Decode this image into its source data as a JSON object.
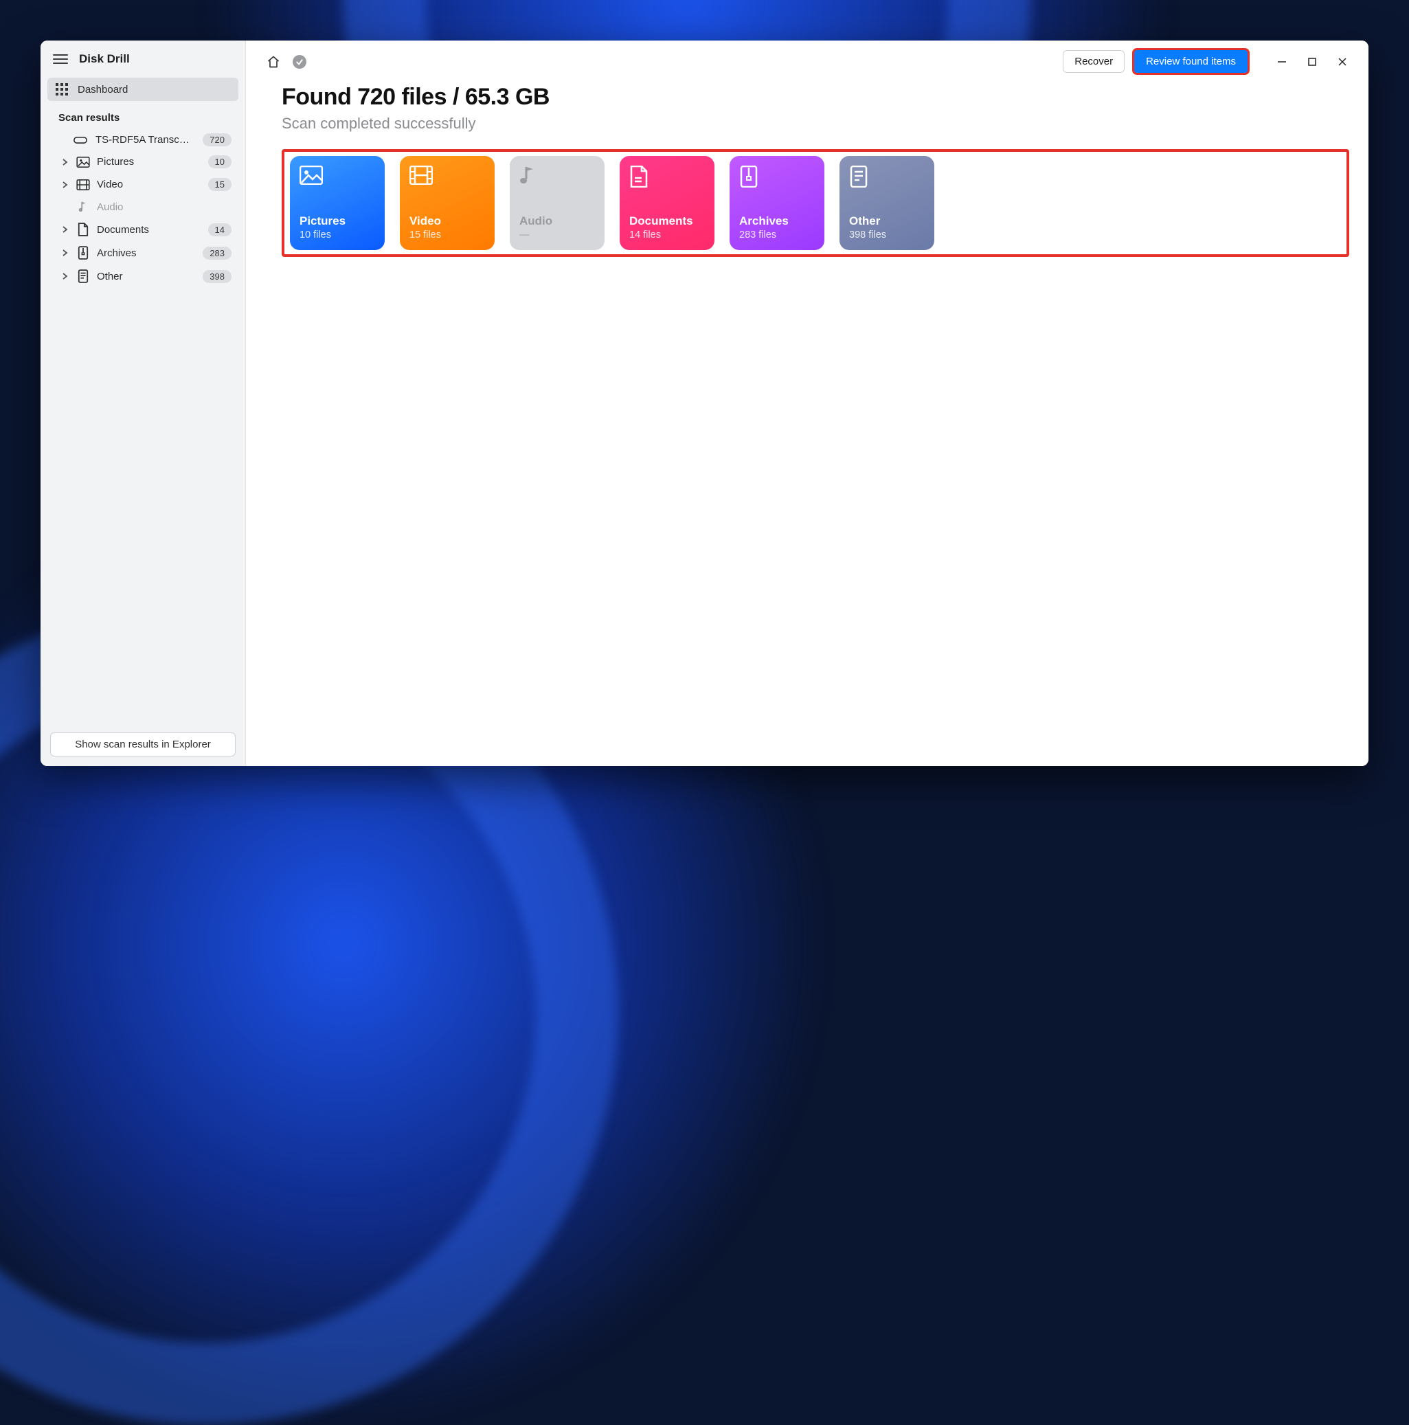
{
  "app": {
    "title": "Disk Drill"
  },
  "sidebar": {
    "dashboard_label": "Dashboard",
    "section_label": "Scan results",
    "device": {
      "name": "TS-RDF5A Transcend US…",
      "count": "720"
    },
    "items": [
      {
        "label": "Pictures",
        "count": "10",
        "disabled": false
      },
      {
        "label": "Video",
        "count": "15",
        "disabled": false
      },
      {
        "label": "Audio",
        "count": "",
        "disabled": true
      },
      {
        "label": "Documents",
        "count": "14",
        "disabled": false
      },
      {
        "label": "Archives",
        "count": "283",
        "disabled": false
      },
      {
        "label": "Other",
        "count": "398",
        "disabled": false
      }
    ],
    "explorer_button": "Show scan results in Explorer"
  },
  "toolbar": {
    "recover_label": "Recover",
    "review_label": "Review found items"
  },
  "summary": {
    "headline": "Found 720 files / 65.3 GB",
    "subline": "Scan completed successfully"
  },
  "cards": [
    {
      "title": "Pictures",
      "sub": "10 files"
    },
    {
      "title": "Video",
      "sub": "15 files"
    },
    {
      "title": "Audio",
      "sub": "—"
    },
    {
      "title": "Documents",
      "sub": "14 files"
    },
    {
      "title": "Archives",
      "sub": "283 files"
    },
    {
      "title": "Other",
      "sub": "398 files"
    }
  ]
}
